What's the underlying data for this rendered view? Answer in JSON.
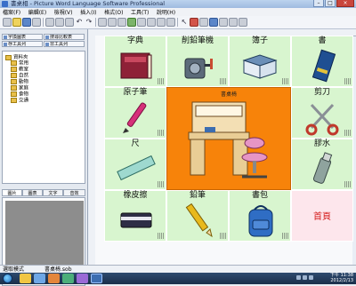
{
  "window": {
    "title": "書桌相 - Picture Word Language Software Professional",
    "controls": [
      "–",
      "□",
      "×"
    ]
  },
  "menu": [
    "檔案(F)",
    "編輯(E)",
    "檢視(V)",
    "插入(I)",
    "格式(O)",
    "工具(T)",
    "說明(H)"
  ],
  "left_panel": {
    "tabs": [
      "字換圖表",
      "搜尋比較表",
      "存工具列",
      "非工具列",
      "圖片圖表存"
    ],
    "tree_root": "資料夾",
    "tree_items": [
      "常用",
      "教室",
      "自然",
      "動物",
      "家庭",
      "食物",
      "交通"
    ],
    "bottom_tabs": [
      "圖片",
      "圖表",
      "文字",
      "音效"
    ]
  },
  "board": {
    "cells": [
      {
        "label": "字典",
        "icon": "dictionary-icon"
      },
      {
        "label": "削鉛筆機",
        "icon": "pencil-sharpener-icon"
      },
      {
        "label": "簿子",
        "icon": "notebook-icon"
      },
      {
        "label": "書",
        "icon": "book-icon"
      },
      {
        "label": "原子筆",
        "icon": "pen-icon"
      },
      {
        "label": "剪刀",
        "icon": "scissors-icon"
      },
      {
        "label": "尺",
        "icon": "ruler-icon"
      },
      {
        "label": "膠水",
        "icon": "glue-icon"
      },
      {
        "label": "橡皮擦",
        "icon": "eraser-icon"
      },
      {
        "label": "鉛筆",
        "icon": "pencil-icon"
      },
      {
        "label": "書包",
        "icon": "school-bag-icon"
      }
    ],
    "center_label": "書桌椅",
    "center_icon": "desk-and-chair-icon",
    "home_label": "首頁"
  },
  "status": {
    "mode": "選取模式",
    "file": "書桌椅.sob"
  },
  "taskbar": {
    "time": "下午 11:38",
    "date": "2012/2/13"
  },
  "colors": {
    "cell_bg": "#d8f5cf",
    "center_bg": "#f7830a",
    "home_bg": "#fde6ec",
    "home_text": "#d51d1d"
  }
}
